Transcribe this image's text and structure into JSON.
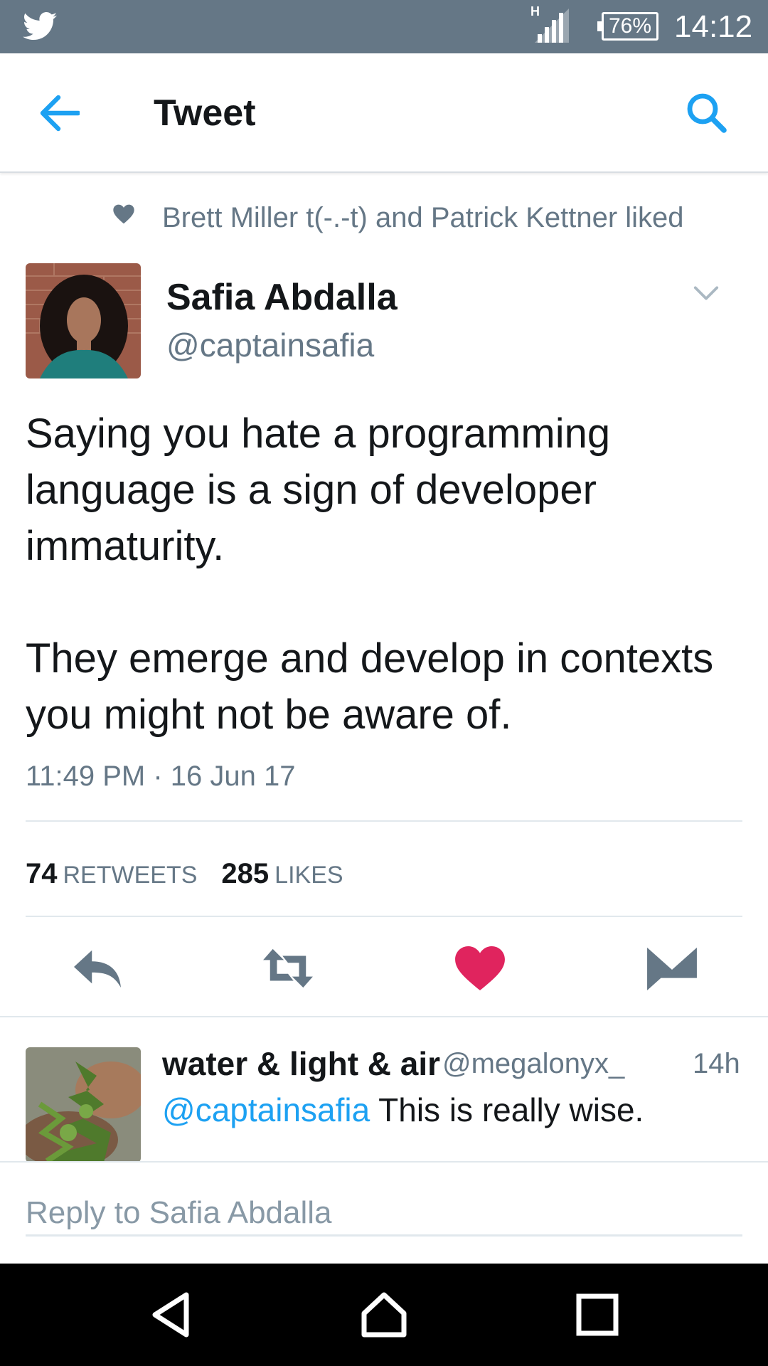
{
  "status_bar": {
    "network_type": "H",
    "battery": "76%",
    "time": "14:12"
  },
  "header": {
    "title": "Tweet"
  },
  "social_context": {
    "text": "Brett Miller t(-.-t) and Patrick Kettner liked"
  },
  "tweet": {
    "author_name": "Safia Abdalla",
    "author_handle": "@captainsafia",
    "text": "Saying you hate a programming\nlanguage is a sign of developer\nimmaturity.\n\nThey emerge and develop in contexts\nyou might not be aware of.",
    "timestamp": "11:49 PM · 16 Jun 17",
    "retweets_count": "74",
    "retweets_label": "RETWEETS",
    "likes_count": "285",
    "likes_label": "LIKES"
  },
  "actions": {
    "reply_icon": "reply-icon",
    "retweet_icon": "retweet-icon",
    "like_icon": "heart-icon",
    "message_icon": "envelope-icon",
    "liked": true
  },
  "reply": {
    "author_name": "water & light & air",
    "author_handle": "@megalonyx_",
    "time": "14h",
    "mention": "@captainsafia",
    "text": " This is really wise."
  },
  "compose": {
    "placeholder": "Reply to Safia Abdalla"
  },
  "colors": {
    "accent": "#1da1f2",
    "like": "#e0245e",
    "muted": "#657786",
    "status_bar": "#657786"
  }
}
